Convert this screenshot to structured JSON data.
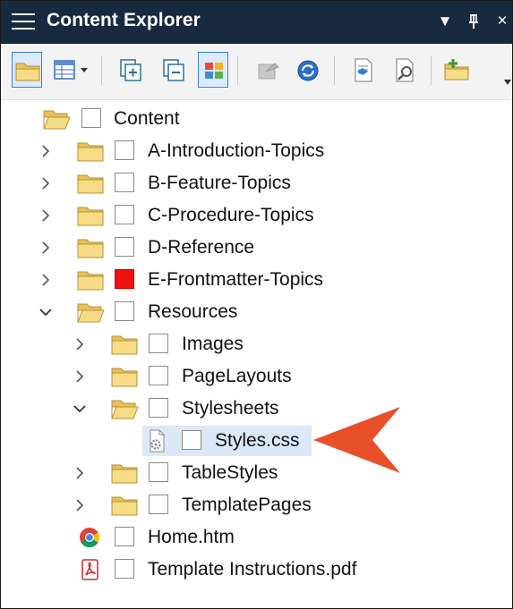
{
  "panel": {
    "title": "Content Explorer",
    "window_buttons": {
      "dropdown": "▼",
      "pin": "🖈",
      "close": "×"
    }
  },
  "toolbar": {
    "items": [
      {
        "name": "open-folder-icon",
        "selected": true
      },
      {
        "name": "view-mode-icon"
      },
      {
        "name": "expand-all-icon"
      },
      {
        "name": "collapse-all-icon"
      },
      {
        "name": "tiles-icon",
        "selected": true
      },
      {
        "name": "bind-icon",
        "disabled": true
      },
      {
        "name": "refresh-icon"
      },
      {
        "name": "document-properties-icon"
      },
      {
        "name": "file-properties-icon"
      },
      {
        "name": "new-folder-icon"
      }
    ]
  },
  "tree": {
    "rows": [
      {
        "label": "Content",
        "icon": "folder-open",
        "level": 0,
        "chevron": "none",
        "checked": false
      },
      {
        "label": "A-Introduction-Topics",
        "icon": "folder",
        "level": 1,
        "chevron": "right",
        "checked": false
      },
      {
        "label": "B-Feature-Topics",
        "icon": "folder",
        "level": 1,
        "chevron": "right",
        "checked": false
      },
      {
        "label": "C-Procedure-Topics",
        "icon": "folder",
        "level": 1,
        "chevron": "right",
        "checked": false
      },
      {
        "label": "D-Reference",
        "icon": "folder",
        "level": 1,
        "chevron": "right",
        "checked": false
      },
      {
        "label": "E-Frontmatter-Topics",
        "icon": "folder",
        "level": 1,
        "chevron": "right",
        "checked": true,
        "check_color": "#ee1111"
      },
      {
        "label": "Resources",
        "icon": "folder-open",
        "level": 1,
        "chevron": "down",
        "checked": false
      },
      {
        "label": "Images",
        "icon": "folder",
        "level": 2,
        "chevron": "right",
        "checked": false
      },
      {
        "label": "PageLayouts",
        "icon": "folder",
        "level": 2,
        "chevron": "right",
        "checked": false
      },
      {
        "label": "Stylesheets",
        "icon": "folder-open",
        "level": 2,
        "chevron": "down",
        "checked": false
      },
      {
        "label": "Styles.css",
        "icon": "css-file",
        "level": 3,
        "chevron": "none",
        "checked": false,
        "selected": true
      },
      {
        "label": "TableStyles",
        "icon": "folder",
        "level": 2,
        "chevron": "right",
        "checked": false
      },
      {
        "label": "TemplatePages",
        "icon": "folder",
        "level": 2,
        "chevron": "right",
        "checked": false
      },
      {
        "label": "Home.htm",
        "icon": "chrome-file",
        "level": 1,
        "chevron": "none",
        "checked": false
      },
      {
        "label": "Template Instructions.pdf",
        "icon": "pdf-file",
        "level": 1,
        "chevron": "none",
        "checked": false
      }
    ]
  },
  "colors": {
    "titlebar": "#172a3f",
    "selection": "#dbe8f7",
    "folder": "#f2d57a",
    "callout_arrow": "#e8502a"
  }
}
